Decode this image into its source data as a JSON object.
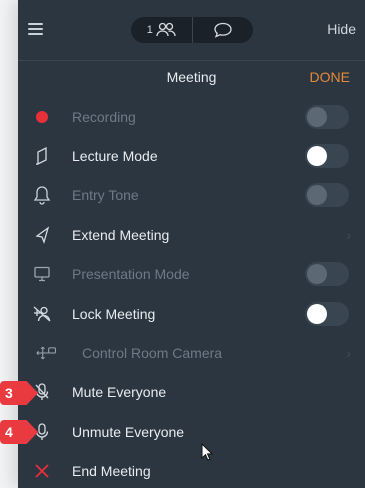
{
  "topbar": {
    "hamburger_icon": "hamburger-menu-icon",
    "participants_count": "1",
    "participants_icon": "people-icon",
    "chat_icon": "chat-bubble-icon",
    "hide_label": "Hide"
  },
  "header": {
    "title": "Meeting",
    "done_label": "DONE"
  },
  "colors": {
    "panel_bg": "#2b3641",
    "accent_orange": "#e58a35",
    "recording_red": "#e8303a",
    "badge_red": "#e83a3f"
  },
  "rows": [
    {
      "label": "Recording",
      "icon": "record-dot-icon",
      "enabled": false,
      "toggle": "off"
    },
    {
      "label": "Lecture Mode",
      "icon": "lecture-flag-icon",
      "enabled": true,
      "toggle": "on"
    },
    {
      "label": "Entry Tone",
      "icon": "bell-icon",
      "enabled": false,
      "toggle": "off"
    },
    {
      "label": "Extend Meeting",
      "icon": "extend-arrow-icon",
      "enabled": true,
      "chevron": true
    },
    {
      "label": "Presentation Mode",
      "icon": "monitor-icon",
      "enabled": false,
      "toggle": "off"
    },
    {
      "label": "Lock Meeting",
      "icon": "lock-person-icon",
      "enabled": true,
      "toggle": "on"
    },
    {
      "label": "Control Room Camera",
      "icon": "camera-control-icon",
      "enabled": false,
      "chevron": true
    },
    {
      "label": "Mute Everyone",
      "icon": "microphone-muted-icon",
      "enabled": true
    },
    {
      "label": "Unmute Everyone",
      "icon": "microphone-icon",
      "enabled": true
    },
    {
      "label": "End Meeting",
      "icon": "close-x-icon",
      "enabled": true
    }
  ],
  "callouts": [
    "3",
    "4"
  ]
}
